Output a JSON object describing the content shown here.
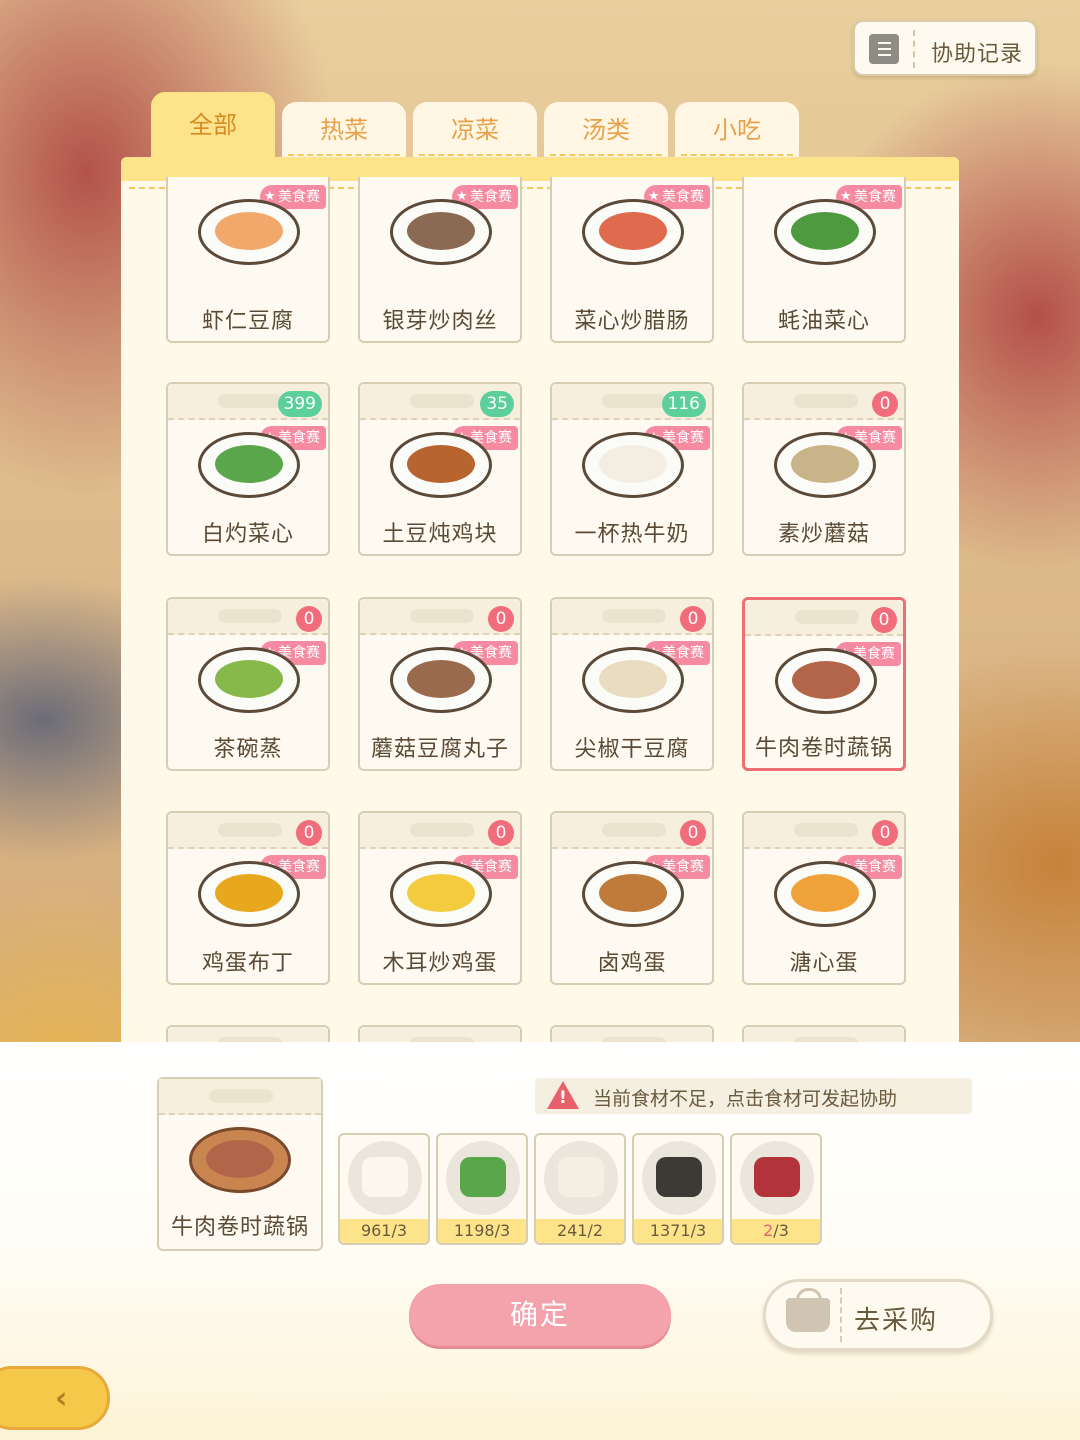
{
  "assist_button": {
    "label": "协助记录",
    "icon": "notebook-icon"
  },
  "tabs": [
    {
      "label": "全部",
      "active": true
    },
    {
      "label": "热菜",
      "active": false
    },
    {
      "label": "凉菜",
      "active": false
    },
    {
      "label": "汤类",
      "active": false
    },
    {
      "label": "小吃",
      "active": false
    }
  ],
  "badge_label": "美食赛",
  "dishes": [
    {
      "name": "虾仁豆腐",
      "count": null,
      "food_color": "#f2a86a"
    },
    {
      "name": "银芽炒肉丝",
      "count": null,
      "food_color": "#8a6a52"
    },
    {
      "name": "菜心炒腊肠",
      "count": null,
      "food_color": "#e06a4e"
    },
    {
      "name": "蚝油菜心",
      "count": null,
      "food_color": "#4e9a3e"
    },
    {
      "name": "白灼菜心",
      "count": "399",
      "count_color": "green",
      "food_color": "#5aa64a"
    },
    {
      "name": "土豆炖鸡块",
      "count": "35",
      "count_color": "green",
      "food_color": "#b8642e"
    },
    {
      "name": "一杯热牛奶",
      "count": "116",
      "count_color": "green",
      "food_color": "#f4ede2"
    },
    {
      "name": "素炒蘑菇",
      "count": "0",
      "count_color": "red",
      "food_color": "#c9b48a"
    },
    {
      "name": "茶碗蒸",
      "count": "0",
      "count_color": "red",
      "food_color": "#86b84a"
    },
    {
      "name": "蘑菇豆腐丸子",
      "count": "0",
      "count_color": "red",
      "food_color": "#9a6a4e"
    },
    {
      "name": "尖椒干豆腐",
      "count": "0",
      "count_color": "red",
      "food_color": "#e9dcc0"
    },
    {
      "name": "牛肉卷时蔬锅",
      "count": "0",
      "count_color": "red",
      "food_color": "#b3654a",
      "selected": true
    },
    {
      "name": "鸡蛋布丁",
      "count": "0",
      "count_color": "red",
      "food_color": "#e8a81e"
    },
    {
      "name": "木耳炒鸡蛋",
      "count": "0",
      "count_color": "red",
      "food_color": "#f2cc3e"
    },
    {
      "name": "卤鸡蛋",
      "count": "0",
      "count_color": "red",
      "food_color": "#c07a3a"
    },
    {
      "name": "溏心蛋",
      "count": "0",
      "count_color": "red",
      "food_color": "#f0a23a"
    }
  ],
  "selected_dish": {
    "name": "牛肉卷时蔬锅",
    "food_color": "#b3654a"
  },
  "warning": {
    "text": "当前食材不足，点击食材可发起协助",
    "icon": "warning-triangle-icon"
  },
  "ingredients": [
    {
      "name": "tofu-icon",
      "have": "961",
      "need": "3",
      "enough": true,
      "color": "#fbf7ee"
    },
    {
      "name": "bok-choy-icon",
      "have": "1198",
      "need": "3",
      "enough": true,
      "color": "#5aa64a"
    },
    {
      "name": "cauliflower-icon",
      "have": "241",
      "need": "2",
      "enough": true,
      "color": "#f3efe2"
    },
    {
      "name": "wood-ear-icon",
      "have": "1371",
      "need": "3",
      "enough": true,
      "color": "#3b3a34"
    },
    {
      "name": "beef-icon",
      "have": "2",
      "need": "3",
      "enough": false,
      "color": "#b2343a"
    }
  ],
  "confirm_button": "确定",
  "shop_button": {
    "label": "去采购",
    "icon": "basket-icon"
  },
  "back_button": {
    "icon": "back-arrow-icon"
  }
}
